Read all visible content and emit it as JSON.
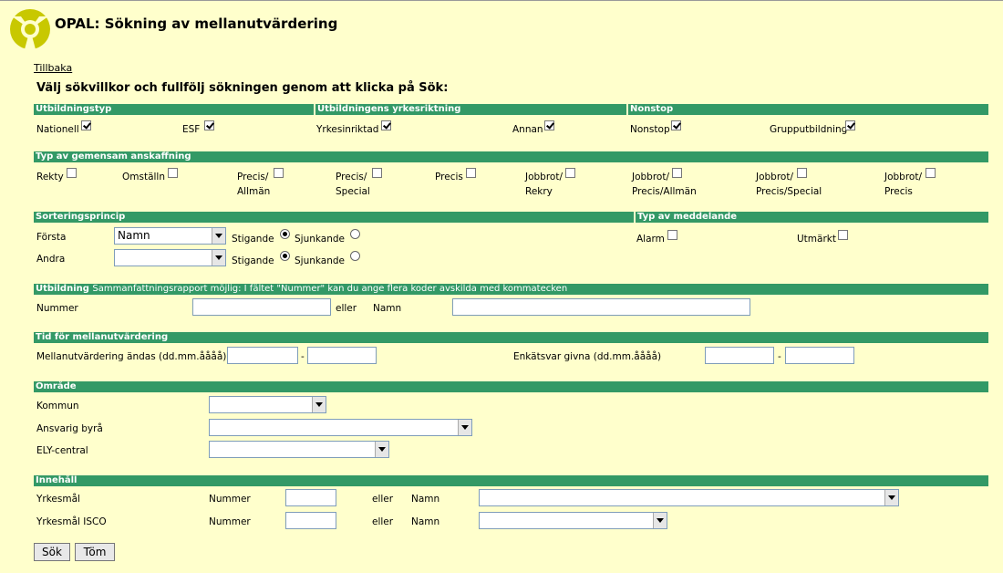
{
  "header": {
    "title": "OPAL: Sökning av mellanutvärdering",
    "back_link": "Tillbaka",
    "instruction": "Välj sökvillkor och fullfölj sökningen genom att klicka på Sök:"
  },
  "utb": {
    "headers": {
      "typ": "Utbildningstyp",
      "riktning": "Utbildningens yrkesriktning",
      "nonstop": "Nonstop"
    },
    "nationell": "Nationell",
    "esf": "ESF",
    "yrkesinriktad": "Yrkesinriktad",
    "annan": "Annan",
    "nonstop": "Nonstop",
    "grupp": "Grupputbildning"
  },
  "anskaffning": {
    "header": "Typ av gemensam anskaffning",
    "rekty": "Rekty",
    "omstalln": "Omställn",
    "precis_allman_1": "Precis/",
    "precis_allman_2": "Allmän",
    "precis_special_1": "Precis/",
    "precis_special_2": "Special",
    "precis": "Precis",
    "jobbrot_rekry_1": "Jobbrot/",
    "jobbrot_rekry_2": "Rekry",
    "jobbrot_pa_1": "Jobbrot/",
    "jobbrot_pa_2": "Precis/Allmän",
    "jobbrot_ps_1": "Jobbrot/",
    "jobbrot_ps_2": "Precis/Special",
    "jobbrot_p_1": "Jobbrot/",
    "jobbrot_p_2": "Precis"
  },
  "sortering": {
    "header": "Sorteringsprincip",
    "forsta": "Första",
    "andra": "Andra",
    "forsta_value": "Namn",
    "andra_value": "",
    "stigande": "Stigande",
    "sjunkande": "Sjunkande"
  },
  "meddelande": {
    "header": "Typ av meddelande",
    "alarm": "Alarm",
    "utmarkt": "Utmärkt"
  },
  "utbildning": {
    "header_bold": "Utbildning",
    "header_note": "Sammanfattningsrapport möjlig: I fältet \"Nummer\" kan du ange flera koder avskilda med kommatecken",
    "nummer": "Nummer",
    "eller": "eller",
    "namn": "Namn"
  },
  "tid": {
    "header": "Tid för mellanutvärdering",
    "andas": "Mellanutvärdering ändas (dd.mm.åååå)",
    "enkat": "Enkätsvar givna (dd.mm.åååå)",
    "dash": "-"
  },
  "omrade": {
    "header": "Område",
    "kommun": "Kommun",
    "byra": "Ansvarig byrå",
    "ely": "ELY-central"
  },
  "innehall": {
    "header": "Innehåll",
    "yrkesmal": "Yrkesmål",
    "yrkesmal_isco": "Yrkesmål ISCO",
    "nummer": "Nummer",
    "eller": "eller",
    "namn": "Namn"
  },
  "buttons": {
    "sok": "Sök",
    "tom": "Töm"
  },
  "colors": {
    "background": "#ffffcc",
    "section_bar": "#339966",
    "logo": "#c8c800"
  }
}
